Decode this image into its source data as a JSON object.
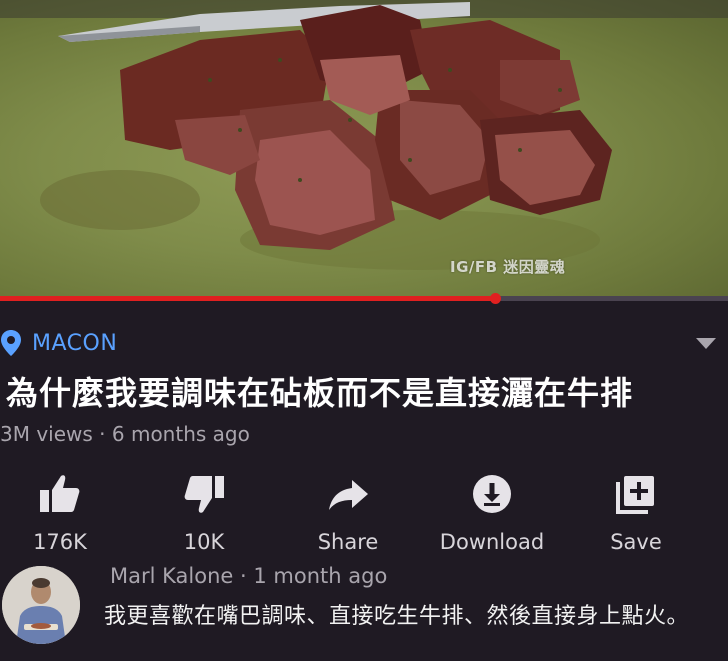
{
  "video": {
    "watermark": "IG/FB 迷因靈魂",
    "progress_fraction": 0.68
  },
  "info": {
    "location": "MACON",
    "title": "為什麼我要調味在砧板而不是直接灑在牛排",
    "meta": "3M views · 6 months ago"
  },
  "actions": [
    {
      "name": "like",
      "icon": "thumbs-up-icon",
      "label": "176K"
    },
    {
      "name": "dislike",
      "icon": "thumbs-down-icon",
      "label": "10K"
    },
    {
      "name": "share",
      "icon": "share-arrow-icon",
      "label": "Share"
    },
    {
      "name": "download",
      "icon": "download-icon",
      "label": "Download"
    },
    {
      "name": "save",
      "icon": "add-to-playlist-icon",
      "label": "Save"
    }
  ],
  "comment": {
    "author": "Marl Kalone",
    "time": "1 month ago",
    "text": "我更喜歡在嘴巴調味、直接吃生牛排、然後直接身上點火。"
  },
  "colors": {
    "background": "#1f1a23",
    "location": "#5aa1ff",
    "progress": "#e02020"
  }
}
